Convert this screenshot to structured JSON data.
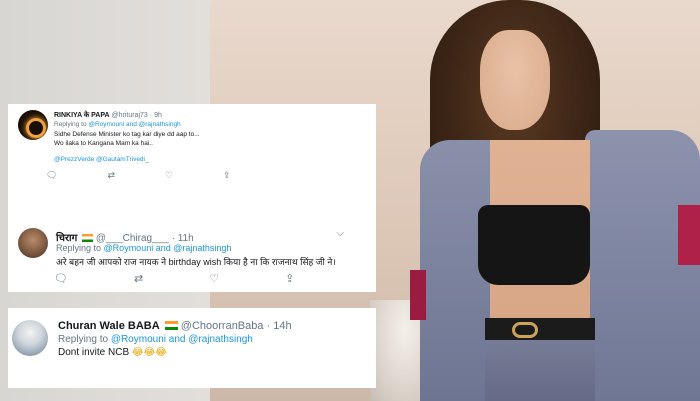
{
  "tweets": [
    {
      "name": "RINKIYA के PAPA",
      "handle": "@hrituraj73",
      "time": "9h",
      "reply_prefix": "Replying to",
      "reply_mentions": "@Roymouni and @rajnathsingh",
      "lines": [
        "Sidhe Defense Minister ko tag kar diye dd aap to...",
        "Wo ilaka to Kangana Mam ka hai.."
      ],
      "mentions_line": "@PrezzVerde @GautamTrivedi_"
    },
    {
      "name": "चिराग",
      "handle": "@___Chirag___",
      "time": "11h",
      "reply_prefix": "Replying to",
      "reply_mentions": "@Roymouni and @rajnathsingh",
      "text": "अरे बहन जी आपको राज नायक ने birthday wish किया है ना कि राजनाथ सिंह जी ने।"
    },
    {
      "name": "Churan Wale BABA",
      "handle": "@ChoorranBaba",
      "time": "14h",
      "reply_prefix": "Replying to",
      "reply_mentions": "@Roymouni and @rajnathsingh",
      "text": "Dont invite NCB",
      "emojis": "😂😂😂"
    }
  ],
  "icons": {
    "reply": "reply-icon",
    "retweet": "retweet-icon",
    "like": "like-icon",
    "share": "share-icon"
  },
  "colors": {
    "link": "#1b95e0",
    "muted": "#657786",
    "text": "#14171a"
  }
}
